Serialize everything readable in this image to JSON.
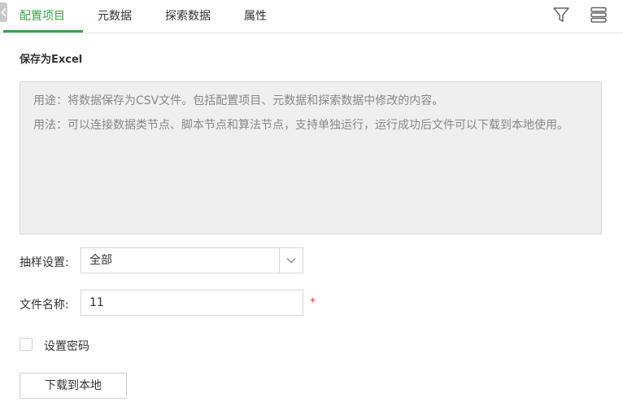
{
  "tabs": [
    {
      "label": "配置项目",
      "active": true
    },
    {
      "label": "元数据",
      "active": false
    },
    {
      "label": "探索数据",
      "active": false
    },
    {
      "label": "属性",
      "active": false
    }
  ],
  "toolbar": {
    "filter_icon": "filter-icon",
    "list_icon": "stacked-list-icon"
  },
  "section_title": "保存为Excel",
  "description": {
    "line1": "用途：将数据保存为CSV文件。包括配置项目、元数据和探索数据中修改的内容。",
    "line2": "用法：可以连接数据类节点、脚本节点和算法节点，支持单独运行，运行成功后文件可以下载到本地使用。"
  },
  "form": {
    "sampling_label": "抽样设置:",
    "sampling_value": "全部",
    "filename_label": "文件名称:",
    "filename_value": "11",
    "required_mark": "*",
    "password_label": "设置密码",
    "password_checked": false,
    "download_button": "下载到本地"
  },
  "colors": {
    "accent": "#3aa24a",
    "required": "#e64545"
  }
}
